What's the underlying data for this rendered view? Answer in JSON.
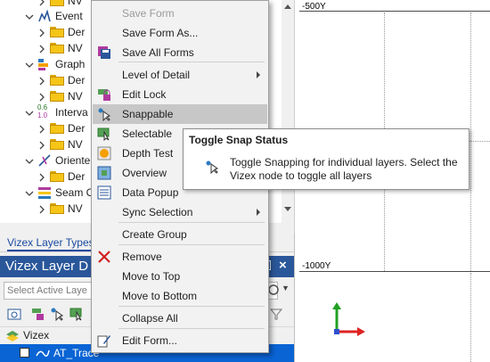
{
  "tree": {
    "items": [
      {
        "label": "NV",
        "type": "folder",
        "level": 2
      },
      {
        "label": "Event",
        "type": "event",
        "level": 1
      },
      {
        "label": "Der",
        "type": "folder",
        "level": 2
      },
      {
        "label": "NV",
        "type": "folder",
        "level": 2
      },
      {
        "label": "Graph",
        "type": "graph",
        "level": 1
      },
      {
        "label": "Der",
        "type": "folder",
        "level": 2
      },
      {
        "label": "NV",
        "type": "folder",
        "level": 2
      },
      {
        "label": "Interva",
        "type": "interval",
        "level": 1
      },
      {
        "label": "Der",
        "type": "folder",
        "level": 2
      },
      {
        "label": "NV",
        "type": "folder",
        "level": 2
      },
      {
        "label": "Oriente",
        "type": "orient",
        "level": 1
      },
      {
        "label": "Der",
        "type": "folder",
        "level": 2
      },
      {
        "label": "Seam C",
        "type": "seam",
        "level": 1
      },
      {
        "label": "NV",
        "type": "folder",
        "level": 2
      }
    ],
    "interval_icon_text": {
      "top": "0.6",
      "bottom": "1.0"
    }
  },
  "tabs": {
    "layer_types": "Vizex Layer Types"
  },
  "dock": {
    "title": "Vizex Layer D",
    "active_layer_placeholder": "Select Active Laye",
    "tree_root": "Vizex",
    "selected_item": "AT_Trace"
  },
  "canvas": {
    "labels": [
      "-500Y",
      "-1000Y"
    ]
  },
  "menu": {
    "items": [
      {
        "label": "Save Form",
        "disabled": true,
        "icon": "none"
      },
      {
        "label": "Save Form As...",
        "icon": "none"
      },
      {
        "label": "Save All Forms",
        "icon": "save-all-icon"
      },
      {
        "label": "Level of Detail",
        "icon": "none",
        "submenu": true
      },
      {
        "label": "Edit Lock",
        "icon": "edit-lock-icon"
      },
      {
        "label": "Snappable",
        "icon": "snappable-icon",
        "hover": true
      },
      {
        "label": "Selectable",
        "icon": "selectable-icon"
      },
      {
        "label": "Depth Test",
        "icon": "depth-test-icon"
      },
      {
        "label": "Overview",
        "icon": "overview-icon"
      },
      {
        "label": "Data Popup",
        "icon": "data-popup-icon"
      },
      {
        "label": "Sync Selection",
        "icon": "none",
        "submenu": true
      },
      {
        "label": "Create Group",
        "icon": "none"
      },
      {
        "label": "Remove",
        "icon": "remove-icon"
      },
      {
        "label": "Move to Top",
        "icon": "none"
      },
      {
        "label": "Move to Bottom",
        "icon": "none"
      },
      {
        "label": "Collapse All",
        "icon": "none"
      },
      {
        "label": "Edit Form...",
        "icon": "edit-form-icon"
      }
    ]
  },
  "tooltip": {
    "title": "Toggle Snap Status",
    "text": "Toggle Snapping for individual layers. Select the Vizex node to toggle all layers"
  },
  "colors": {
    "accent": "#2a579a",
    "selection": "#0a64d4",
    "menu_hover": "#c7c7c7"
  }
}
